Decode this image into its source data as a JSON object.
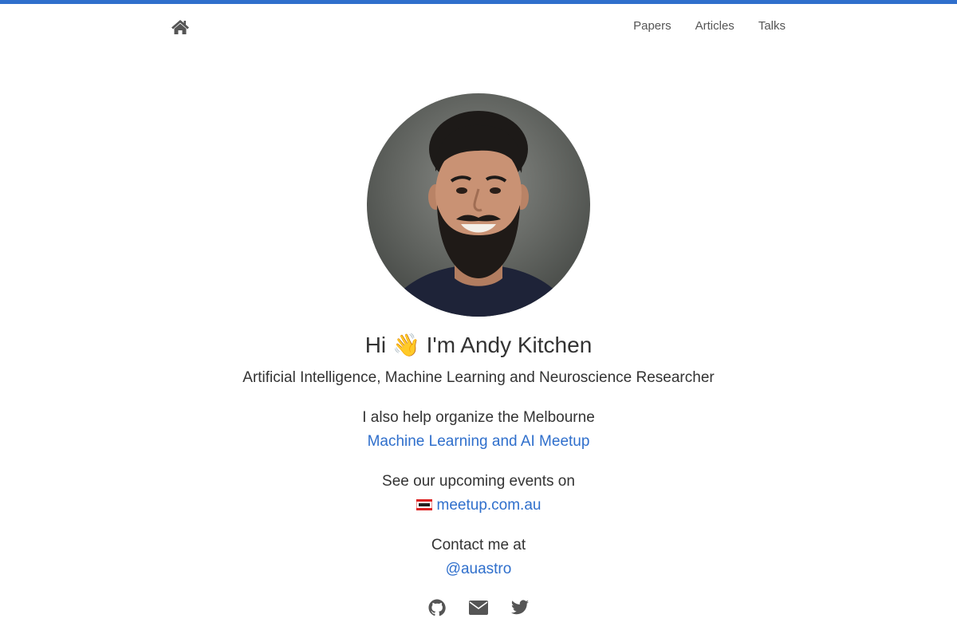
{
  "nav": {
    "home_icon": "home-icon",
    "links": [
      "Papers",
      "Articles",
      "Talks"
    ]
  },
  "profile": {
    "avatar_alt": "avatar-photo",
    "greeting_pre": "Hi",
    "greeting_emoji": "👋",
    "greeting_post": "I'm Andy Kitchen",
    "subtitle": "Artificial Intelligence, Machine Learning and Neuroscience Researcher"
  },
  "organize": {
    "text": "I also help organize the Melbourne",
    "link": "Machine Learning and AI Meetup"
  },
  "events": {
    "text": "See our upcoming events on",
    "logo_icon": "meetup-logo-icon",
    "link": "meetup.com.au"
  },
  "contact": {
    "text": "Contact me at",
    "link": "@auastro"
  },
  "socials": [
    "github-icon",
    "envelope-icon",
    "twitter-icon"
  ],
  "colors": {
    "accent": "#2f6fcc",
    "text": "#333333",
    "nav_text": "#555555"
  }
}
